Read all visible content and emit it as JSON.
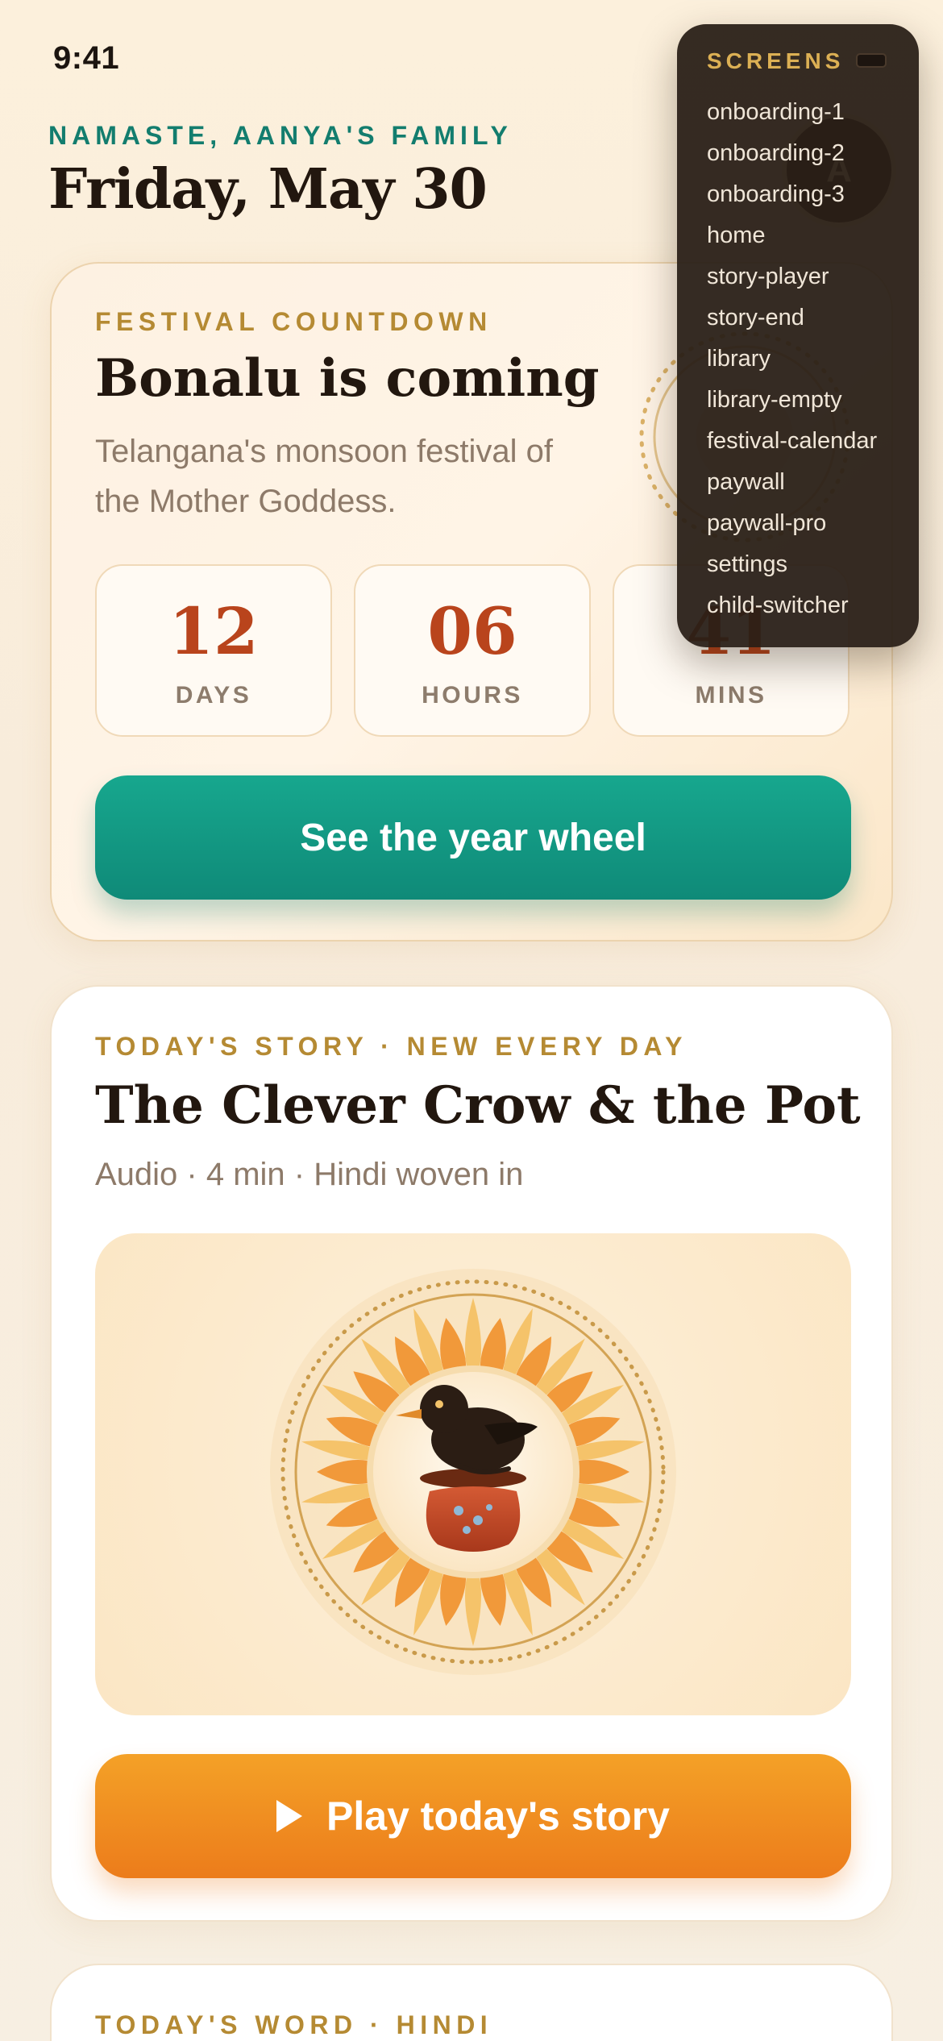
{
  "status_bar": {
    "time": "9:41"
  },
  "header": {
    "greeting": "NAMASTE, AANYA'S FAMILY",
    "date": "Friday, May 30",
    "avatar_initial": "A"
  },
  "festival_card": {
    "eyebrow": "FESTIVAL COUNTDOWN",
    "title": "Bonalu is coming",
    "subtitle_line1": "Telangana's monsoon festival of",
    "subtitle_line2": "the Mother Goddess.",
    "countdown": [
      {
        "value": "12",
        "label": "DAYS"
      },
      {
        "value": "06",
        "label": "HOURS"
      },
      {
        "value": "41",
        "label": "MINS"
      }
    ],
    "cta": "See the year wheel"
  },
  "story_card": {
    "eyebrow": "TODAY'S STORY · NEW EVERY DAY",
    "title": "The Clever Crow & the Pot",
    "meta": "Audio · 4 min · Hindi woven in",
    "cta": "Play today's story",
    "cta_icon": "play-icon"
  },
  "word_card": {
    "eyebrow": "TODAY'S WORD · HINDI"
  },
  "screens_overlay": {
    "heading": "SCREENS",
    "items": [
      "onboarding-1",
      "onboarding-2",
      "onboarding-3",
      "home",
      "story-player",
      "story-end",
      "library",
      "library-empty",
      "festival-calendar",
      "paywall",
      "paywall-pro",
      "settings",
      "child-switcher"
    ]
  },
  "colors": {
    "teal": "#137d6e",
    "gold": "#b58a33",
    "rust": "#b9441c",
    "orange": "#ec7c1b"
  }
}
